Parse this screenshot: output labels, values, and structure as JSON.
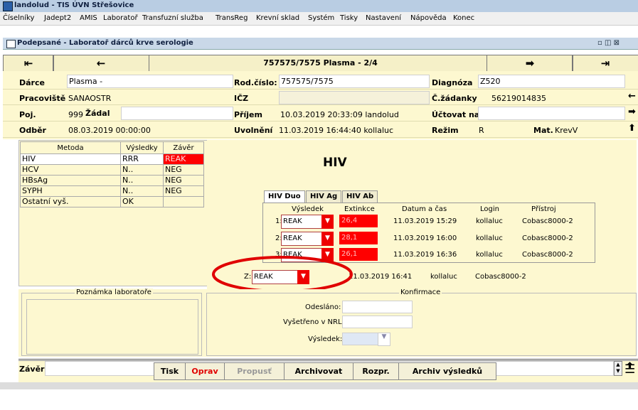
{
  "app": {
    "title": "landolud - TIS ÚVN Střešovice"
  },
  "menu": [
    "Číselníky",
    "Jadept2",
    "AMIS",
    "Laboratoř",
    "Transfuzní služba",
    "TransReg",
    "Krevní sklad",
    "Systém",
    "Tisky",
    "Nastavení",
    "Nápověda",
    "Konec"
  ],
  "window": {
    "title": "Podepsané - Laboratoř dárců krve serologie",
    "controls": "▫ ◫ ⊠"
  },
  "nav": {
    "title": "757575/7575 Plasma - 2/4",
    "first": "⇤",
    "prev": "←",
    "next": "➡",
    "last": "⇥"
  },
  "form": {
    "darce_label": "Dárce",
    "darce_value": "Plasma -",
    "rodcislo_label": "Rod.číslo:",
    "rodcislo_value": "757575/7575",
    "diagnoza_label": "Diagnóza",
    "diagnoza_value": "Z520",
    "pracoviste_label": "Pracoviště",
    "pracoviste_value": "SANAOSTR",
    "icz_label": "IČZ",
    "icz_value": "",
    "cislo_zadanky_label": "Č.žádanky",
    "cislo_zadanky_value": "56219014835",
    "poj_label": "Poj.",
    "poj_value": "999",
    "zadal_label": "Žádal",
    "zadal_value": "",
    "prijem_label": "Příjem",
    "prijem_value": "10.03.2019 20:33:09 landolud",
    "uctovat_label": "Účtovat na",
    "uctovat_value": "",
    "odber_label": "Odběr",
    "odber_value": "08.03.2019 00:00:00",
    "uvolneni_label": "Uvolnění",
    "uvolneni_value": "11.03.2019 16:44:40 kollaluc",
    "rezim_label": "Režim",
    "rezim_value": "R",
    "mat_label": "Mat.",
    "mat_value": "KrevV"
  },
  "methods": {
    "headers": [
      "Metoda",
      "Výsledky",
      "Závěr"
    ],
    "rows": [
      {
        "metoda": "HIV",
        "vysledky": "RRR",
        "zaver": "REAK",
        "highlight": "#ff0000"
      },
      {
        "metoda": "HCV",
        "vysledky": "N..",
        "zaver": "NEG"
      },
      {
        "metoda": "HBsAg",
        "vysledky": "N..",
        "zaver": "NEG"
      },
      {
        "metoda": "SYPH",
        "vysledky": "N..",
        "zaver": "NEG"
      },
      {
        "metoda": "Ostatní vyš.",
        "vysledky": "OK",
        "zaver": ""
      }
    ]
  },
  "detail": {
    "title": "HIV",
    "tabs": [
      "HIV Duo",
      "HIV Ag",
      "HIV Ab"
    ],
    "headers": [
      "Výsledek",
      "Extinkce",
      "Datum a čas",
      "Login",
      "Přístroj"
    ],
    "rows": [
      {
        "n": "1:",
        "vysledek": "REAK",
        "extinkce": "26,4",
        "datum": "11.03.2019 15:29",
        "login": "kollaluc",
        "pristroj": "Cobasc8000-2"
      },
      {
        "n": "2:",
        "vysledek": "REAK",
        "extinkce": "28,1",
        "datum": "11.03.2019 16:00",
        "login": "kollaluc",
        "pristroj": "Cobasc8000-2"
      },
      {
        "n": "3:",
        "vysledek": "REAK",
        "extinkce": "26,1",
        "datum": "11.03.2019 16:36",
        "login": "kollaluc",
        "pristroj": "Cobasc8000-2"
      }
    ],
    "z_label": "Z:",
    "z_value": "REAK",
    "z_datum": "11.03.2019 16:41",
    "z_login": "kollaluc",
    "z_pristroj": "Cobasc8000-2"
  },
  "poznamka": {
    "title": "Poznámka laboratoře"
  },
  "konfirmace": {
    "title": "Konfirmace",
    "odeslano_label": "Odesláno:",
    "vysetreno_label": "Vyšetřeno v NRL:",
    "vysledek_label": "Výsledek:"
  },
  "zaver": {
    "label": "Závěr",
    "value": ""
  },
  "buttons": [
    "Tisk",
    "Oprav",
    "Propusť",
    "Archivovat",
    "Rozpr.",
    "Archiv výsledků"
  ],
  "colors": {
    "accent_red": "#ff0000",
    "panel": "#fdf8d0"
  }
}
